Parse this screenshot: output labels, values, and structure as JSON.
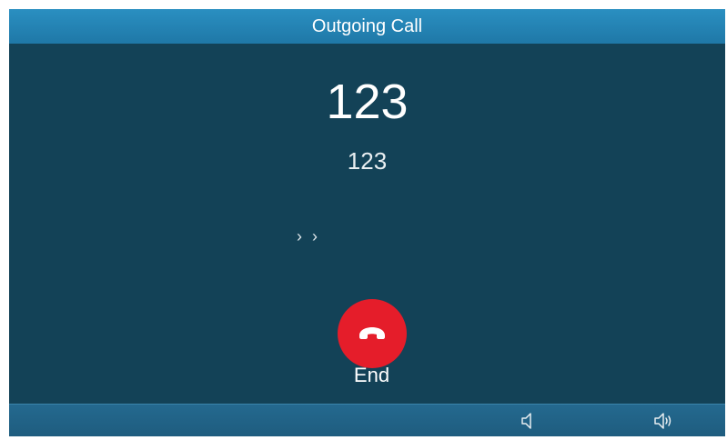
{
  "header": {
    "title": "Outgoing Call"
  },
  "call": {
    "name": "123",
    "number": "123",
    "progress_indicator": "› ›"
  },
  "end_button": {
    "label": "End",
    "icon": "hang-up-icon",
    "color": "#e51d2a"
  },
  "softkeys": [
    {
      "icon": "handset-speaker-icon"
    },
    {
      "icon": "speakerphone-icon"
    }
  ],
  "colors": {
    "background": "#134257",
    "header": "#2a8fc1",
    "softkey_bar": "#24698f"
  }
}
